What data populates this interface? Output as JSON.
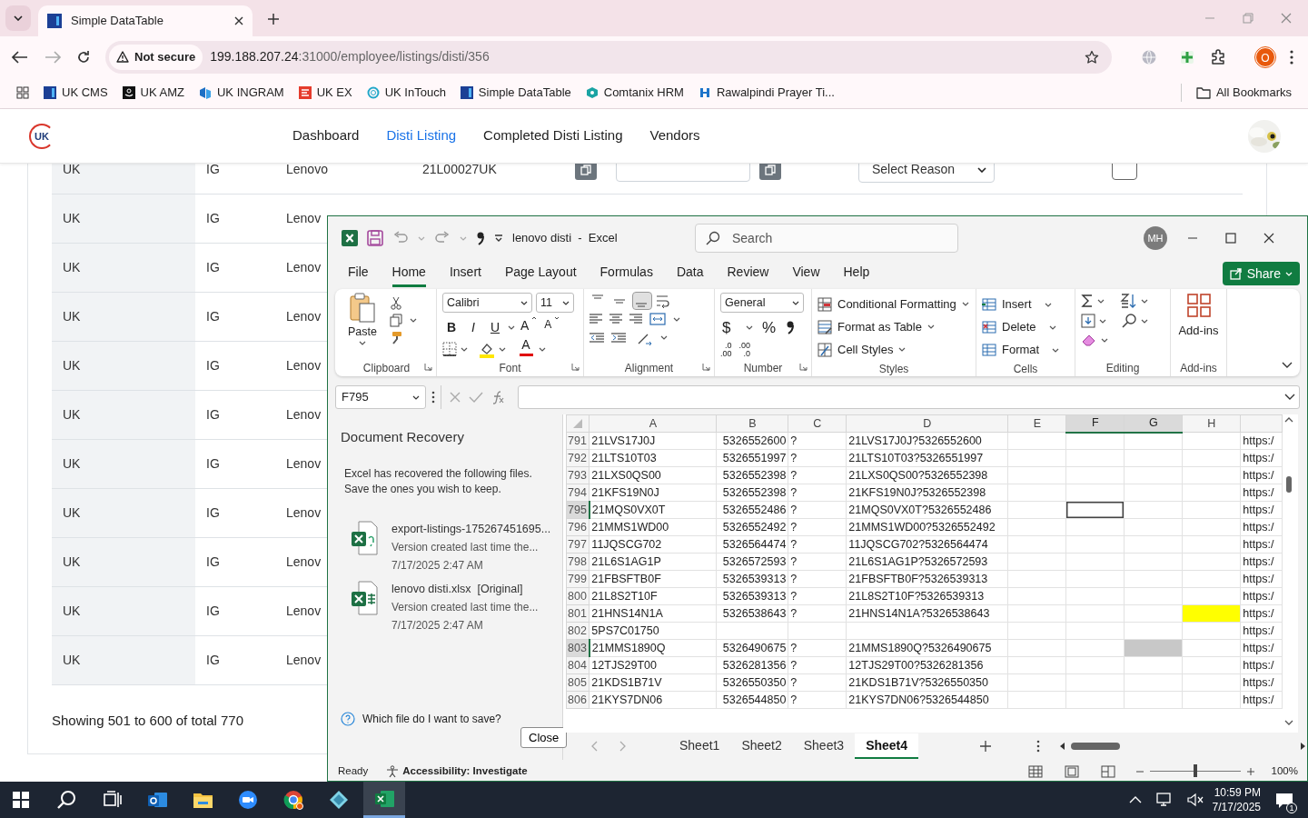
{
  "browser": {
    "tab": {
      "title": "Simple DataTable"
    },
    "security": "Not secure",
    "url_host": "199.188.207.24",
    "url_path": ":31000/employee/listings/disti/356",
    "profile": "O",
    "bookmarks": [
      {
        "label": "UK CMS",
        "kind": "df"
      },
      {
        "label": "UK AMZ",
        "kind": "amazon"
      },
      {
        "label": "UK INGRAM",
        "kind": "ingram"
      },
      {
        "label": "UK EX",
        "kind": "ex"
      },
      {
        "label": "UK InTouch",
        "kind": "intouch"
      },
      {
        "label": "Simple DataTable",
        "kind": "df"
      },
      {
        "label": "Comtanix HRM",
        "kind": "comtanix"
      },
      {
        "label": "Rawalpindi Prayer Ti...",
        "kind": "prayer"
      }
    ],
    "all_bookmarks": "All Bookmarks"
  },
  "site": {
    "logo": "UK",
    "nav": [
      {
        "label": "Dashboard",
        "selected": false
      },
      {
        "label": "Disti Listing",
        "selected": true
      },
      {
        "label": "Completed Disti Listing",
        "selected": false
      },
      {
        "label": "Vendors",
        "selected": false
      }
    ],
    "rows": [
      {
        "country": "UK",
        "region": "IG",
        "brand": "Lenovo",
        "model": "21L00027UK",
        "reason": "Select Reason",
        "checked": false
      },
      {
        "country": "UK",
        "region": "IG",
        "brand": "Lenov"
      },
      {
        "country": "UK",
        "region": "IG",
        "brand": "Lenov"
      },
      {
        "country": "UK",
        "region": "IG",
        "brand": "Lenov"
      },
      {
        "country": "UK",
        "region": "IG",
        "brand": "Lenov"
      },
      {
        "country": "UK",
        "region": "IG",
        "brand": "Lenov"
      },
      {
        "country": "UK",
        "region": "IG",
        "brand": "Lenov"
      },
      {
        "country": "UK",
        "region": "IG",
        "brand": "Lenov"
      },
      {
        "country": "UK",
        "region": "IG",
        "brand": "Lenov"
      },
      {
        "country": "UK",
        "region": "IG",
        "brand": "Lenov"
      },
      {
        "country": "UK",
        "region": "IG",
        "brand": "Lenov"
      }
    ],
    "footer": "Showing 501 to 600 of total 770"
  },
  "excel": {
    "title": "lenovo disti  -  Excel",
    "search_placeholder": "Search",
    "user": "MH",
    "share": "Share",
    "menu": [
      {
        "label": "File",
        "selected": false
      },
      {
        "label": "Home",
        "selected": true
      },
      {
        "label": "Insert",
        "selected": false
      },
      {
        "label": "Page Layout",
        "selected": false
      },
      {
        "label": "Formulas",
        "selected": false
      },
      {
        "label": "Data",
        "selected": false
      },
      {
        "label": "Review",
        "selected": false
      },
      {
        "label": "View",
        "selected": false
      },
      {
        "label": "Help",
        "selected": false
      }
    ],
    "ribbon": {
      "clipboard": {
        "label": "Clipboard",
        "paste": "Paste"
      },
      "font": {
        "label": "Font",
        "family": "Calibri",
        "size": "11",
        "styles": [
          "B",
          "I",
          "U"
        ],
        "grow": "A",
        "shrink": "A",
        "color_button": "A"
      },
      "alignment": {
        "label": "Alignment",
        "vertical": [
          {
            "kind": "top",
            "selected": false
          },
          {
            "kind": "middle",
            "selected": false
          },
          {
            "kind": "bottom",
            "selected": true
          }
        ]
      },
      "number": {
        "label": "Number",
        "format": "General",
        "symbols": [
          "$",
          "%"
        ],
        "decimals": [
          {
            "top": ".0",
            "bottom": ".00"
          },
          {
            "top": ".00",
            "bottom": ".0"
          }
        ]
      },
      "styles": {
        "label": "Styles",
        "items": [
          "Conditional Formatting",
          "Format as Table",
          "Cell Styles"
        ]
      },
      "cells": {
        "label": "Cells",
        "items": [
          "Insert",
          "Delete",
          "Format"
        ]
      },
      "editing": {
        "label": "Editing"
      },
      "addins": {
        "label": "Add-ins",
        "button": "Add-ins"
      }
    },
    "name_box": "F795",
    "recovery": {
      "title": "Document Recovery",
      "message": "Excel has recovered the following files.  Save the ones you wish to keep.",
      "files": [
        {
          "name": "export-listings-175267451695...",
          "note": "Version created last time the...",
          "date": "7/17/2025 2:47 AM",
          "kind": "csv"
        },
        {
          "name": "lenovo disti.xlsx  [Original]",
          "note": "Version created last time the...",
          "date": "7/17/2025 2:47 AM",
          "kind": "xlsx"
        }
      ],
      "help": "Which file do I want to save?",
      "close": "Close"
    },
    "grid": {
      "columns": [
        {
          "label": "A",
          "selected": false
        },
        {
          "label": "B",
          "selected": false
        },
        {
          "label": "C",
          "selected": false
        },
        {
          "label": "D",
          "selected": false
        },
        {
          "label": "E",
          "selected": false
        },
        {
          "label": "F",
          "selected": true
        },
        {
          "label": "G",
          "selected": true
        },
        {
          "label": "H",
          "selected": false
        }
      ],
      "rows": [
        {
          "number": "791",
          "selected": false,
          "cells": [
            "21LVS17J0J",
            "5326552600",
            "?",
            "21LVS17J0J?5326552600",
            null,
            null,
            null,
            null,
            "https:/"
          ]
        },
        {
          "number": "792",
          "selected": false,
          "cells": [
            "21LTS10T03",
            "5326551997",
            "?",
            "21LTS10T03?5326551997",
            null,
            null,
            null,
            null,
            "https:/"
          ]
        },
        {
          "number": "793",
          "selected": false,
          "cells": [
            "21LXS0QS00",
            "5326552398",
            "?",
            "21LXS0QS00?5326552398",
            null,
            null,
            null,
            null,
            "https:/"
          ]
        },
        {
          "number": "794",
          "selected": false,
          "cells": [
            "21KFS19N0J",
            "5326552398",
            "?",
            "21KFS19N0J?5326552398",
            null,
            null,
            null,
            null,
            "https:/"
          ]
        },
        {
          "number": "795",
          "selected": true,
          "cells": [
            "21MQS0VX0T",
            "5326552486",
            "?",
            "21MQS0VX0T?5326552486",
            null,
            {
              "active": true
            },
            null,
            null,
            "https:/"
          ]
        },
        {
          "number": "796",
          "selected": false,
          "cells": [
            "21MMS1WD00",
            "5326552492",
            "?",
            "21MMS1WD00?5326552492",
            null,
            null,
            null,
            null,
            "https:/"
          ]
        },
        {
          "number": "797",
          "selected": false,
          "cells": [
            "11JQSCG702",
            "5326564474",
            "?",
            "11JQSCG702?5326564474",
            null,
            null,
            null,
            null,
            "https:/"
          ]
        },
        {
          "number": "798",
          "selected": false,
          "cells": [
            "21L6S1AG1P",
            "5326572593",
            "?",
            "21L6S1AG1P?5326572593",
            null,
            null,
            null,
            null,
            "https:/"
          ]
        },
        {
          "number": "799",
          "selected": false,
          "cells": [
            "21FBSFTB0F",
            "5326539313",
            "?",
            "21FBSFTB0F?5326539313",
            null,
            null,
            null,
            null,
            "https:/"
          ]
        },
        {
          "number": "800",
          "selected": false,
          "cells": [
            "21L8S2T10F",
            "5326539313",
            "?",
            "21L8S2T10F?5326539313",
            null,
            null,
            null,
            null,
            "https:/"
          ]
        },
        {
          "number": "801",
          "selected": false,
          "cells": [
            "21HNS14N1A",
            "5326538643",
            "?",
            "21HNS14N1A?5326538643",
            null,
            null,
            null,
            {
              "color": "#ffff00"
            },
            "https:/"
          ]
        },
        {
          "number": "802",
          "selected": false,
          "cells": [
            "5PS7C01750",
            null,
            null,
            null,
            null,
            null,
            null,
            null,
            "https:/"
          ]
        },
        {
          "number": "803",
          "selected": true,
          "cells": [
            "21MMS1890Q",
            "5326490675",
            "?",
            "21MMS1890Q?5326490675",
            null,
            null,
            {
              "selected": true
            },
            null,
            "https:/"
          ]
        },
        {
          "number": "804",
          "selected": false,
          "cells": [
            "12TJS29T00",
            "5326281356",
            "?",
            "12TJS29T00?5326281356",
            null,
            null,
            null,
            null,
            "https:/"
          ]
        },
        {
          "number": "805",
          "selected": false,
          "cells": [
            "21KDS1B71V",
            "5326550350",
            "?",
            "21KDS1B71V?5326550350",
            null,
            null,
            null,
            null,
            "https:/"
          ]
        },
        {
          "number": "806",
          "selected": false,
          "cells": [
            "21KYS7DN06",
            "5326544850",
            "?",
            "21KYS7DN06?5326544850",
            null,
            null,
            null,
            null,
            "https:/"
          ]
        }
      ]
    },
    "sheets": [
      {
        "label": "Sheet1",
        "selected": false
      },
      {
        "label": "Sheet2",
        "selected": false
      },
      {
        "label": "Sheet3",
        "selected": false
      },
      {
        "label": "Sheet4",
        "selected": true
      }
    ],
    "status": {
      "ready": "Ready",
      "accessibility": "Accessibility: Investigate",
      "zoom": "100%",
      "zoom_slider": {
        "level": 0.5
      }
    }
  },
  "taskbar": {
    "apps": [
      {
        "kind": "search",
        "selected": false
      },
      {
        "kind": "taskview",
        "selected": false
      },
      {
        "kind": "mail",
        "selected": false
      },
      {
        "kind": "folder",
        "selected": false
      },
      {
        "kind": "video",
        "selected": false
      },
      {
        "kind": "browser",
        "selected": false
      },
      {
        "kind": "diamond",
        "selected": false
      },
      {
        "kind": "excel",
        "selected": true
      }
    ],
    "time": "10:59 PM",
    "date": "7/17/2025",
    "notifications": "1"
  }
}
